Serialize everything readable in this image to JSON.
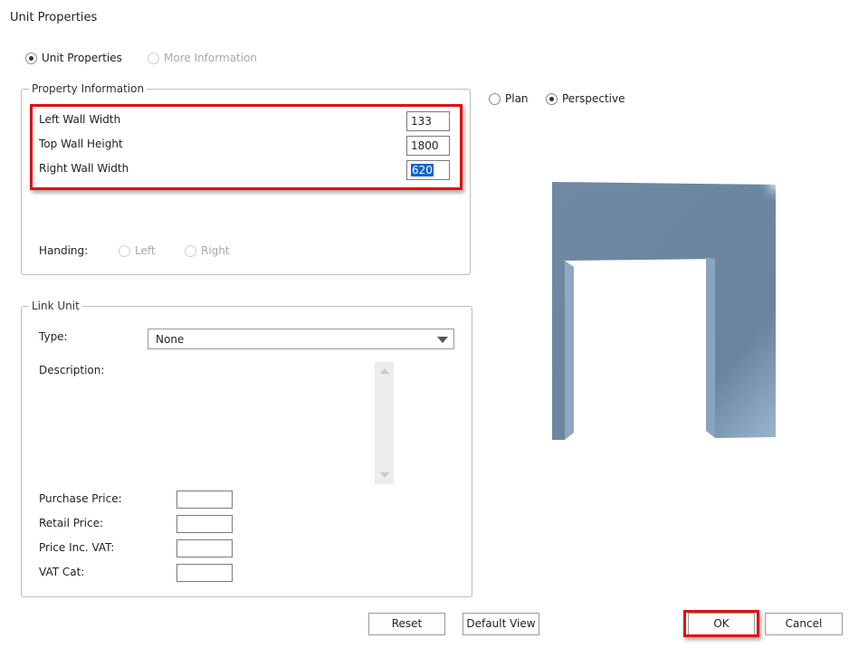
{
  "window": {
    "title": "Unit Properties"
  },
  "view_mode": {
    "unit_properties_label": "Unit Properties",
    "more_information_label": "More Information"
  },
  "property_information": {
    "legend": "Property Information",
    "left_wall_width": {
      "label": "Left Wall Width",
      "value": "133"
    },
    "top_wall_height": {
      "label": "Top Wall Height",
      "value": "1800"
    },
    "right_wall_width": {
      "label": "Right Wall Width",
      "value": "620"
    },
    "handing": {
      "label": "Handing:",
      "left": "Left",
      "right": "Right"
    }
  },
  "link_unit": {
    "legend": "Link Unit",
    "type_label": "Type:",
    "type_value": "None",
    "description_label": "Description:",
    "purchase_price_label": "Purchase Price:",
    "retail_price_label": "Retail Price:",
    "price_inc_vat_label": "Price Inc. VAT:",
    "vat_cat_label": "VAT Cat:"
  },
  "preview": {
    "plan_label": "Plan",
    "perspective_label": "Perspective",
    "selected": "Perspective",
    "model_color": "#6f89a3"
  },
  "buttons": {
    "reset": "Reset",
    "default_view": "Default View",
    "ok": "OK",
    "cancel": "Cancel"
  },
  "colors": {
    "highlight": "#e01010",
    "selection": "#0a64d2"
  }
}
